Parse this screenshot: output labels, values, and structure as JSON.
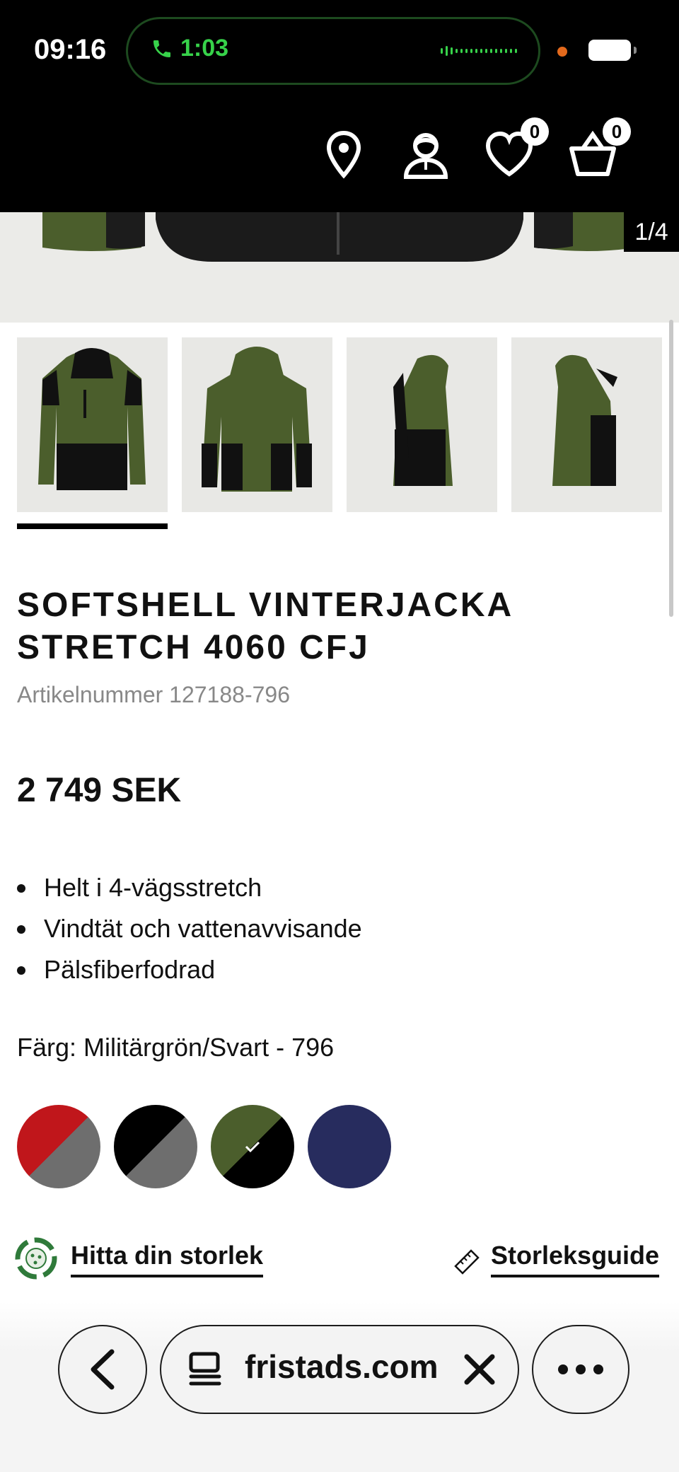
{
  "status_bar": {
    "time": "09:16",
    "call_duration": "1:03"
  },
  "header": {
    "wishlist_count": "0",
    "cart_count": "0"
  },
  "gallery": {
    "counter": "1/4"
  },
  "product": {
    "title": "SOFTSHELL VINTERJACKA STRETCH 4060 CFJ",
    "article_number": "Artikelnummer 127188-796",
    "price": "2 749 SEK",
    "features": [
      "Helt i 4-vägsstretch",
      "Vindtät och vattenavvisande",
      "Pälsfiberfodrad"
    ],
    "color_label": "Färg: Militärgrön/Svart - 796"
  },
  "swatches": [
    {
      "name": "red-grey",
      "colors": [
        "#c0161b",
        "#6e6e6e"
      ]
    },
    {
      "name": "black-grey",
      "colors": [
        "#000000",
        "#6e6e6e"
      ]
    },
    {
      "name": "military-green-black",
      "colors": [
        "#4b5e2c",
        "#000000"
      ],
      "selected": true
    },
    {
      "name": "navy",
      "colors": [
        "#272c5e",
        "#272c5e"
      ]
    }
  ],
  "size": {
    "fit_link": "Hitta din storlek",
    "guide_link": "Storleksguide"
  },
  "browser": {
    "url": "fristads.com"
  },
  "colors": {
    "call_green": "#37d24a",
    "jacket_green": "#4b5e2c"
  }
}
